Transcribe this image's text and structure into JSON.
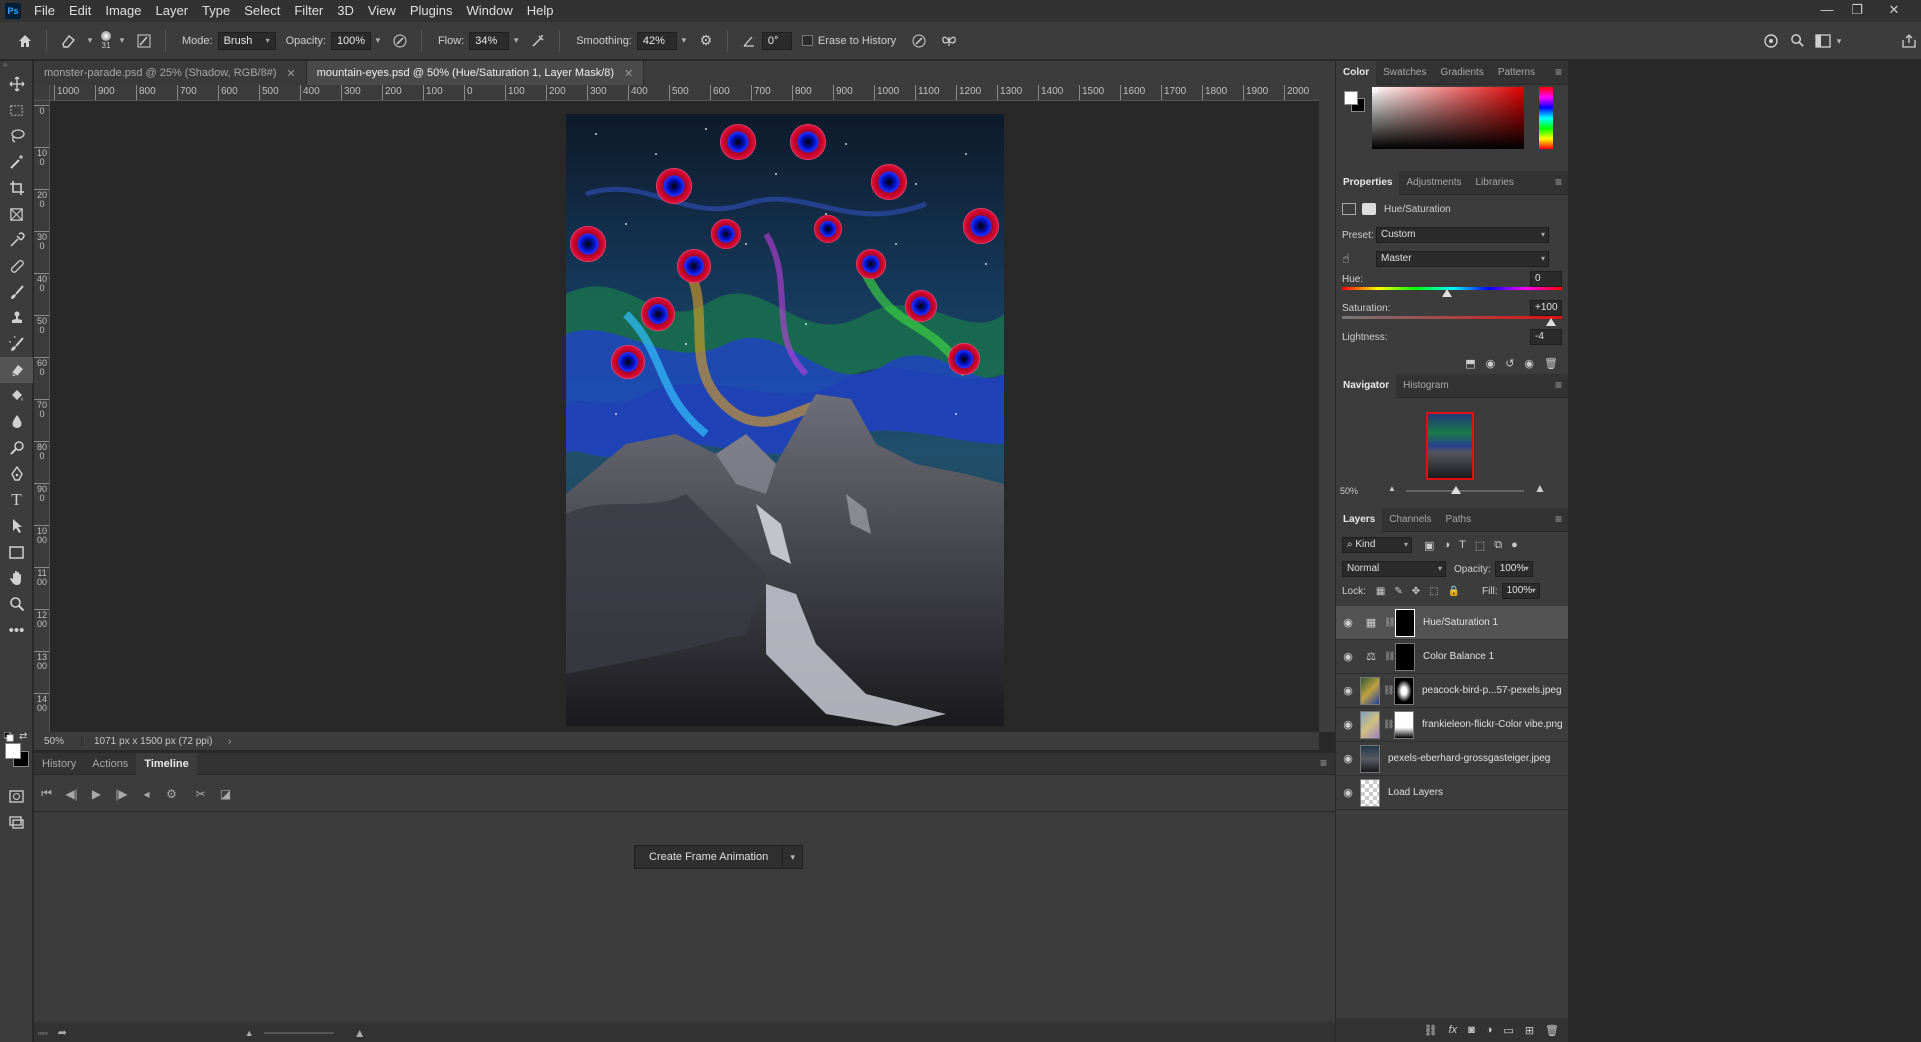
{
  "app": {
    "logo": "Ps",
    "menus": [
      "File",
      "Edit",
      "Image",
      "Layer",
      "Type",
      "Select",
      "Filter",
      "3D",
      "View",
      "Plugins",
      "Window",
      "Help"
    ],
    "window_controls": {
      "minimize": "—",
      "restore": "❐",
      "close": "✕"
    }
  },
  "options": {
    "brush_size": "31",
    "mode_label": "Mode:",
    "mode_value": "Brush",
    "opacity_label": "Opacity:",
    "opacity_value": "100%",
    "flow_label": "Flow:",
    "flow_value": "34%",
    "smoothing_label": "Smoothing:",
    "smoothing_value": "42%",
    "angle_value": "0°",
    "erase_history_label": "Erase to History"
  },
  "documents": [
    {
      "title": "monster-parade.psd @ 25% (Shadow, RGB/8#)",
      "active": false
    },
    {
      "title": "mountain-eyes.psd @ 50% (Hue/Saturation 1, Layer Mask/8)",
      "active": true
    }
  ],
  "ruler": {
    "h_labels": [
      "1000",
      "900",
      "800",
      "700",
      "600",
      "500",
      "400",
      "300",
      "200",
      "100",
      "0",
      "100",
      "200",
      "300",
      "400",
      "500",
      "600",
      "700",
      "800",
      "900",
      "1000",
      "1100",
      "1200",
      "1300",
      "1400",
      "1500",
      "1600",
      "1700",
      "1800",
      "1900",
      "2000"
    ],
    "v_labels": [
      "0",
      "100",
      "200",
      "300",
      "400",
      "500",
      "600",
      "700",
      "800",
      "900",
      "1000",
      "1100",
      "1200",
      "1300",
      "1400"
    ]
  },
  "status": {
    "zoom": "50%",
    "info": "1071 px x 1500 px (72 ppi)",
    "arrow": "›"
  },
  "bottom_panel": {
    "tabs": [
      "History",
      "Actions",
      "Timeline"
    ],
    "active_tab": "Timeline",
    "create_button": "Create Frame Animation"
  },
  "color_panel": {
    "tabs": [
      "Color",
      "Swatches",
      "Gradients",
      "Patterns"
    ]
  },
  "properties": {
    "tabs": [
      "Properties",
      "Adjustments",
      "Libraries"
    ],
    "title": "Hue/Saturation",
    "preset_label": "Preset:",
    "preset_value": "Custom",
    "channel_value": "Master",
    "hue_label": "Hue:",
    "hue_value": "0",
    "saturation_label": "Saturation:",
    "saturation_value": "+100",
    "lightness_label": "Lightness:",
    "lightness_value": "-4",
    "hue_level": 0.5,
    "saturation_level": 1.0
  },
  "navigator": {
    "tabs": [
      "Navigator",
      "Histogram"
    ],
    "zoom": "50%",
    "zoom_level": 0.42
  },
  "layers_panel": {
    "tabs": [
      "Layers",
      "Channels",
      "Paths"
    ],
    "kind_label": "Kind",
    "blend_mode": "Normal",
    "opacity_label": "Opacity:",
    "opacity_value": "100%",
    "lock_label": "Lock:",
    "fill_label": "Fill:",
    "fill_value": "100%",
    "layers": [
      {
        "name": "Hue/Saturation 1",
        "selected": true
      },
      {
        "name": "Color Balance 1",
        "selected": false
      },
      {
        "name": "peacock-bird-p...57-pexels.jpeg",
        "selected": false
      },
      {
        "name": "frankieleon-flickr-Color vibe.png",
        "selected": false
      },
      {
        "name": "pexels-eberhard-grossgasteiger.jpeg",
        "selected": false
      },
      {
        "name": "Load Layers",
        "selected": false
      }
    ]
  }
}
